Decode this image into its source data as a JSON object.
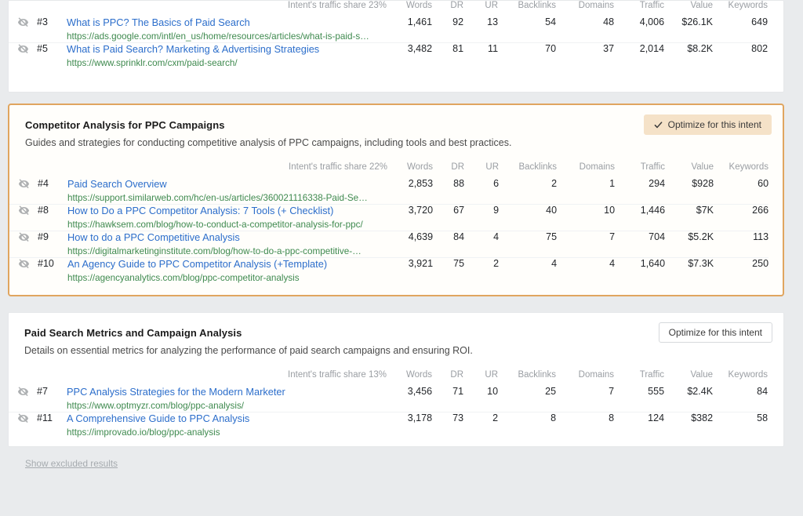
{
  "columns": [
    "Words",
    "DR",
    "UR",
    "Backlinks",
    "Domains",
    "Traffic",
    "Value",
    "Keywords"
  ],
  "colors": {
    "highlight_border": "#e0a55f",
    "highlight_button_bg": "#f5e2c8",
    "link_blue": "#2c6ecb",
    "url_green": "#3f8a4f",
    "page_bg": "#e9ebed"
  },
  "icons": {
    "eye_hidden": "eye-slash-icon",
    "check": "check-icon"
  },
  "footer": {
    "show_excluded_label": "Show excluded results"
  },
  "cards": [
    {
      "id": "card-partial-top",
      "highlighted": false,
      "title": "",
      "description": "",
      "intent_share": "Intent's traffic share 23%",
      "optimize_label": "",
      "rows": [
        {
          "rank": "#3",
          "title": "What is PPC? The Basics of Paid Search",
          "url": "https://ads.google.com/intl/en_us/home/resources/articles/what-is-paid-s…",
          "words": "1,461",
          "dr": "92",
          "ur": "13",
          "backlinks": "54",
          "domains": "48",
          "traffic": "4,006",
          "value": "$26.1K",
          "keywords": "649"
        },
        {
          "rank": "#5",
          "title": "What is Paid Search? Marketing & Advertising Strategies",
          "url": "https://www.sprinklr.com/cxm/paid-search/",
          "words": "3,482",
          "dr": "81",
          "ur": "11",
          "backlinks": "70",
          "domains": "37",
          "traffic": "2,014",
          "value": "$8.2K",
          "keywords": "802"
        }
      ]
    },
    {
      "id": "card-competitor-analysis",
      "highlighted": true,
      "title": "Competitor Analysis for PPC Campaigns",
      "description": "Guides and strategies for conducting competitive analysis of PPC campaigns, including tools and best practices.",
      "intent_share": "Intent's traffic share 22%",
      "optimize_label": "Optimize for this intent",
      "rows": [
        {
          "rank": "#4",
          "title": "Paid Search Overview",
          "url": "https://support.similarweb.com/hc/en-us/articles/360021116338-Paid-Se…",
          "words": "2,853",
          "dr": "88",
          "ur": "6",
          "backlinks": "2",
          "domains": "1",
          "traffic": "294",
          "value": "$928",
          "keywords": "60"
        },
        {
          "rank": "#8",
          "title": "How to Do a PPC Competitor Analysis: 7 Tools (+ Checklist)",
          "url": "https://hawksem.com/blog/how-to-conduct-a-competitor-analysis-for-ppc/",
          "words": "3,720",
          "dr": "67",
          "ur": "9",
          "backlinks": "40",
          "domains": "10",
          "traffic": "1,446",
          "value": "$7K",
          "keywords": "266"
        },
        {
          "rank": "#9",
          "title": "How to do a PPC Competitive Analysis",
          "url": "https://digitalmarketinginstitute.com/blog/how-to-do-a-ppc-competitive-…",
          "words": "4,639",
          "dr": "84",
          "ur": "4",
          "backlinks": "75",
          "domains": "7",
          "traffic": "704",
          "value": "$5.2K",
          "keywords": "113"
        },
        {
          "rank": "#10",
          "title": "An Agency Guide to PPC Competitor Analysis (+Template)",
          "url": "https://agencyanalytics.com/blog/ppc-competitor-analysis",
          "words": "3,921",
          "dr": "75",
          "ur": "2",
          "backlinks": "4",
          "domains": "4",
          "traffic": "1,640",
          "value": "$7.3K",
          "keywords": "250"
        }
      ]
    },
    {
      "id": "card-paid-search-metrics",
      "highlighted": false,
      "title": "Paid Search Metrics and Campaign Analysis",
      "description": "Details on essential metrics for analyzing the performance of paid search campaigns and ensuring ROI.",
      "intent_share": "Intent's traffic share 13%",
      "optimize_label": "Optimize for this intent",
      "rows": [
        {
          "rank": "#7",
          "title": "PPC Analysis Strategies for the Modern Marketer",
          "url": "https://www.optmyzr.com/blog/ppc-analysis/",
          "words": "3,456",
          "dr": "71",
          "ur": "10",
          "backlinks": "25",
          "domains": "7",
          "traffic": "555",
          "value": "$2.4K",
          "keywords": "84"
        },
        {
          "rank": "#11",
          "title": "A Comprehensive Guide to PPC Analysis",
          "url": "https://improvado.io/blog/ppc-analysis",
          "words": "3,178",
          "dr": "73",
          "ur": "2",
          "backlinks": "8",
          "domains": "8",
          "traffic": "124",
          "value": "$382",
          "keywords": "58"
        }
      ]
    }
  ]
}
